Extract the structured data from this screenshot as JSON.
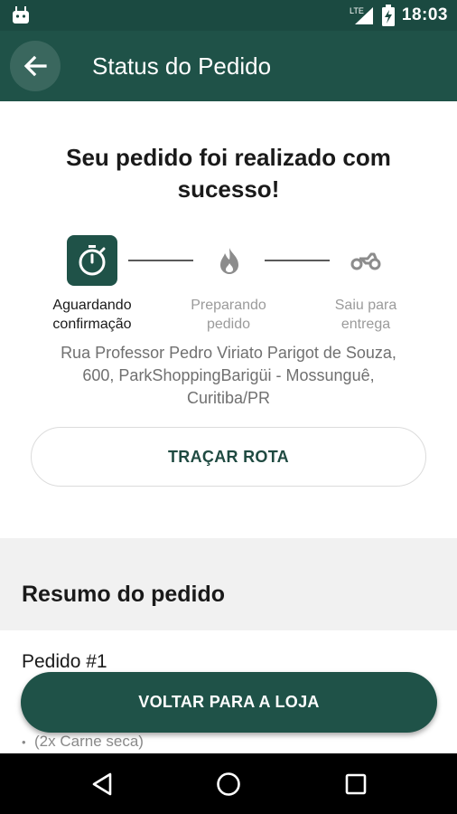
{
  "status_bar": {
    "time": "18:03",
    "network": "LTE",
    "icons": [
      "android-icon",
      "signal-icon",
      "battery-icon"
    ]
  },
  "app_bar": {
    "title": "Status do Pedido",
    "back_icon": "arrow-left-icon"
  },
  "main": {
    "success_message": "Seu pedido foi realizado com sucesso!",
    "steps": [
      {
        "label_line1": "Aguardando",
        "label_line2": "confirmação",
        "icon": "stopwatch-icon",
        "state": "active"
      },
      {
        "label_line1": "Preparando",
        "label_line2": "pedido",
        "icon": "flame-icon",
        "state": "pending"
      },
      {
        "label_line1": "Saiu para",
        "label_line2": "entrega",
        "icon": "motorcycle-icon",
        "state": "pending"
      }
    ],
    "address_line1": "Rua Professor Pedro Viriato Parigot de Souza,",
    "address_line2": "600, ParkShoppingBarigüi - Mossunguê,",
    "address_line3": "Curitiba/PR",
    "route_button": "TRAÇAR ROTA"
  },
  "summary": {
    "title": "Resumo do pedido",
    "order_label": "Pedido #1",
    "item_text": "(2x Carne seca)"
  },
  "footer": {
    "back_to_store": "VOLTAR PARA A LOJA"
  },
  "colors": {
    "status_bar": "#1b4a41",
    "app_bar": "#1f5248",
    "accent": "#1f5248",
    "muted_text": "#9b9b9b"
  },
  "nav_bar": {
    "icons": [
      "back-triangle-icon",
      "home-circle-icon",
      "recents-square-icon"
    ]
  }
}
